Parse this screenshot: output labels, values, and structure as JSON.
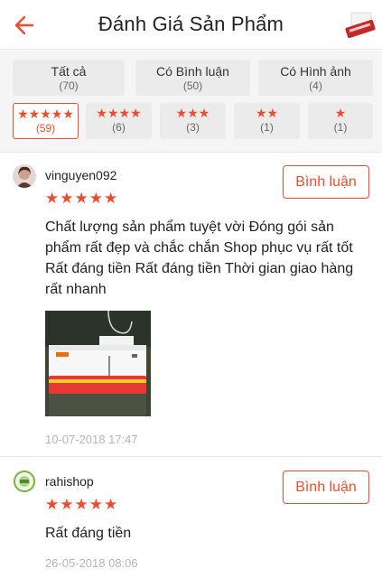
{
  "header": {
    "title": "Đánh Giá Sản Phẩm",
    "back_icon": "back-arrow-icon",
    "accent_color": "#ee4d2d"
  },
  "filters": {
    "tabs": [
      {
        "label": "Tất cả",
        "count": "(70)"
      },
      {
        "label": "Có Bình luận",
        "count": "(50)"
      },
      {
        "label": "Có Hình ảnh",
        "count": "(4)"
      }
    ],
    "star_tabs": [
      {
        "stars": "★★★★★",
        "count": "(59)",
        "selected": true
      },
      {
        "stars": "★★★★",
        "count": "(6)",
        "selected": false
      },
      {
        "stars": "★★★",
        "count": "(3)",
        "selected": false
      },
      {
        "stars": "★★",
        "count": "(1)",
        "selected": false
      },
      {
        "stars": "★",
        "count": "(1)",
        "selected": false
      }
    ]
  },
  "reviews": [
    {
      "username": "vinguyen092",
      "rating_stars": "★★★★★",
      "rating": 5,
      "reply_label": "Bình luận",
      "comment": "Chất lượng sản phẩm tuyệt vời Đóng gói sản phẩm rất đẹp và chắc chắn Shop phục vụ rất tốt Rất đáng tiền Rất đáng tiền Thời gian giao hàng rất nhanh",
      "date": "10-07-2018 17:47"
    },
    {
      "username": "rahishop",
      "rating_stars": "★★★★★",
      "rating": 5,
      "reply_label": "Bình luận",
      "comment": "Rất đáng tiền",
      "date": "26-05-2018 08:06"
    }
  ]
}
